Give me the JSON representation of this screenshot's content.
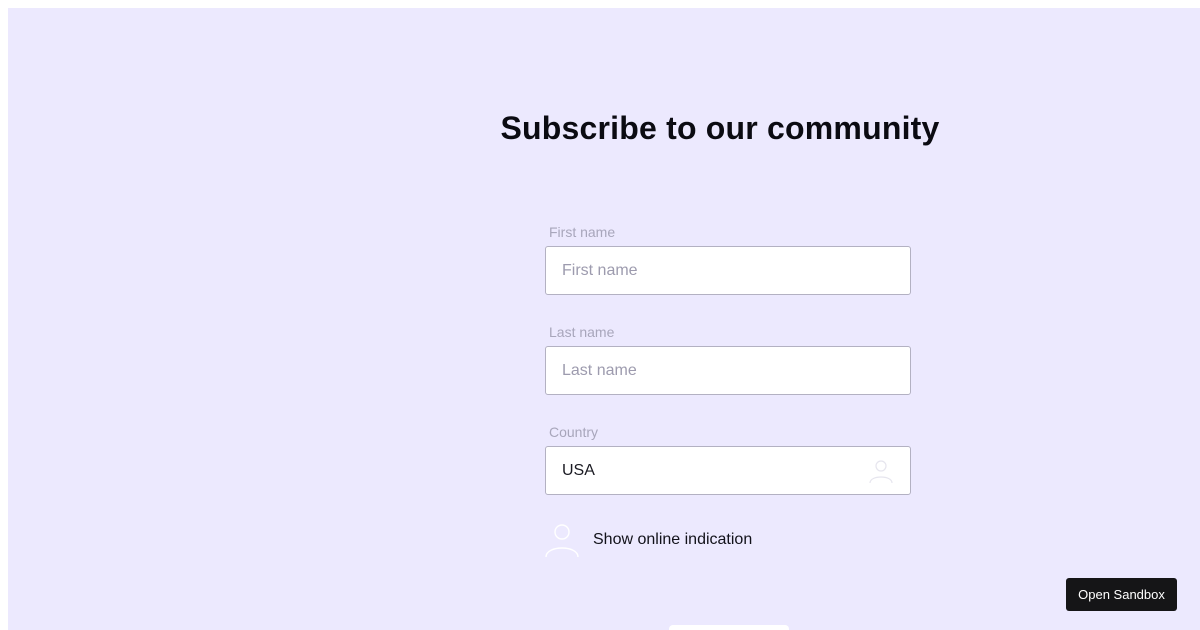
{
  "form": {
    "title": "Subscribe to our community",
    "first_name": {
      "label": "First name",
      "placeholder": "First name",
      "value": ""
    },
    "last_name": {
      "label": "Last name",
      "placeholder": "Last name",
      "value": ""
    },
    "country": {
      "label": "Country",
      "selected": "USA",
      "icon": "user-icon"
    },
    "online_toggle": {
      "label": "Show online indication",
      "icon": "user-icon"
    }
  },
  "sandbox_button": {
    "label": "Open Sandbox"
  },
  "colors": {
    "background": "#ece9fe",
    "button": "#151517",
    "label": "#a8a6bb"
  }
}
